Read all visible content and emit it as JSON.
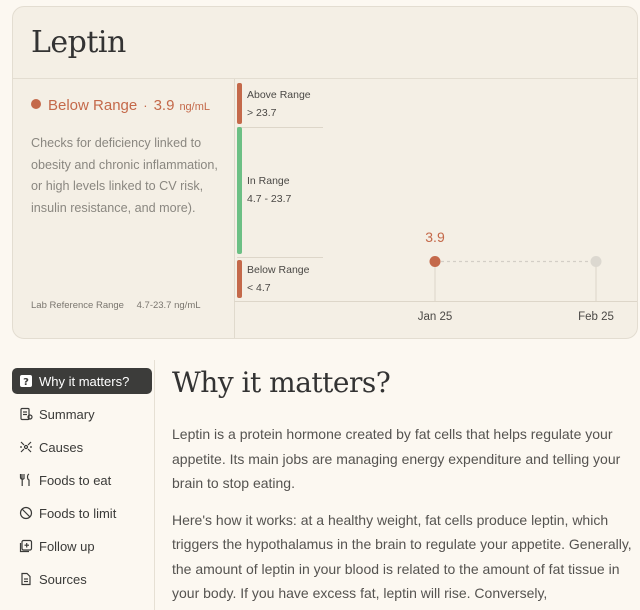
{
  "card": {
    "title": "Leptin",
    "status_label": "Below Range",
    "status_separator": "·",
    "value": "3.9",
    "unit": "ng/mL",
    "description": "Checks for deficiency linked to obesity and chronic inflammation, or high levels linked to CV risk, insulin resistance, and more).",
    "ref_label": "Lab Reference Range",
    "ref_value": "4.7-23.7 ng/mL"
  },
  "ranges": {
    "above": {
      "title": "Above Range",
      "value": "> 23.7",
      "color": "#c4694a"
    },
    "in": {
      "title": "In Range",
      "value": "4.7 - 23.7",
      "color": "#6cbf84"
    },
    "below": {
      "title": "Below Range",
      "value": "< 4.7",
      "color": "#c4694a"
    }
  },
  "chart_data": {
    "type": "line",
    "x": [
      "Jan 25",
      "Feb 25"
    ],
    "series": [
      {
        "values": [
          3.9,
          null
        ]
      }
    ],
    "point_labels": [
      "3.9",
      ""
    ],
    "colors": {
      "measured": "#c4694a",
      "future": "#dcd8d0"
    }
  },
  "nav": {
    "items": [
      {
        "label": "Why it matters?",
        "icon": "question-icon",
        "active": true
      },
      {
        "label": "Summary",
        "icon": "summary-icon",
        "active": false
      },
      {
        "label": "Causes",
        "icon": "causes-icon",
        "active": false
      },
      {
        "label": "Foods to eat",
        "icon": "utensils-icon",
        "active": false
      },
      {
        "label": "Foods to limit",
        "icon": "prohibited-icon",
        "active": false
      },
      {
        "label": "Follow up",
        "icon": "follow-up-icon",
        "active": false
      },
      {
        "label": "Sources",
        "icon": "document-icon",
        "active": false
      }
    ]
  },
  "article": {
    "title": "Why it matters?",
    "paragraphs": [
      "Leptin is a protein hormone created by fat cells that helps regulate your appetite. Its main jobs are managing energy expenditure and telling your brain to stop eating.",
      "Here's how it works: at a healthy weight, fat cells produce leptin, which triggers the hypothalamus in the brain to regulate your appetite. Generally, the amount of leptin in your blood is related to the amount of fat tissue in your body. If you have excess fat, leptin will rise. Conversely,"
    ]
  }
}
